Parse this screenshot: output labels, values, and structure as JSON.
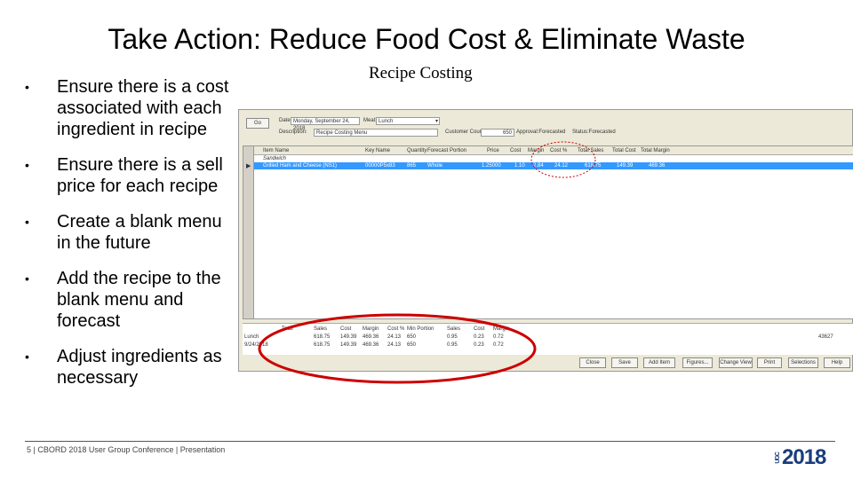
{
  "slide": {
    "title": "Take Action:  Reduce Food Cost & Eliminate Waste",
    "caption": "Recipe Costing",
    "bullets": [
      "Ensure there is a cost associated with each ingredient in recipe",
      "Ensure there is a sell price for each recipe",
      "Create a blank menu in the future",
      "Add the recipe to the blank menu and forecast",
      "Adjust ingredients as necessary"
    ],
    "footer": "5 | CBORD 2018 User Group Conference | Presentation",
    "logo": "2018",
    "logo_prefix": "UGC"
  },
  "app": {
    "go_button": "Go",
    "date_label": "Date:",
    "date_value": "Monday, September 24, 2018",
    "meal_label": "Meal:",
    "meal_value": "Lunch",
    "description_label": "Description:",
    "description_value": "Recipe Costing Menu",
    "customer_count_label": "Customer Count:",
    "customer_count_value": "650",
    "approval": "Approval:Forecasted",
    "status": "Status:Forecasted",
    "columns": [
      "Item Name",
      "Key Name",
      "Quantity",
      "Forecast Portion",
      "Price",
      "Cost",
      "Margin",
      "Cost %",
      "Total Sales",
      "Total Cost",
      "Total Margin"
    ],
    "group": "Sandwich",
    "row": [
      "Grilled Ham and Cheese (NS1)",
      "00000P5x83",
      "865",
      "Whole",
      "1.25000",
      "1.10",
      "2.84",
      "24.12",
      "618.75",
      "149.39",
      "469.36"
    ],
    "summary_columns": [
      "Total",
      "Sales",
      "Cost",
      "Margin",
      "Cost %",
      "Min Portion",
      "Sales",
      "Cost",
      "Margin"
    ],
    "summary_rows": [
      [
        "Lunch",
        "618.75",
        "149.39",
        "469.36",
        "24.13",
        "650",
        "0.95",
        "0.23",
        "0.72"
      ],
      [
        "9/24/2018",
        "618.75",
        "149.39",
        "469.36",
        "24.13",
        "650",
        "0.95",
        "0.23",
        "0.72"
      ]
    ],
    "record_id": "43627",
    "buttons": [
      "Close",
      "Save",
      "Add Item",
      "Figures...",
      "Change View",
      "Print",
      "Selections",
      "Help"
    ],
    "highlight_color": "#cc0000",
    "selection_color": "#3399ff"
  }
}
